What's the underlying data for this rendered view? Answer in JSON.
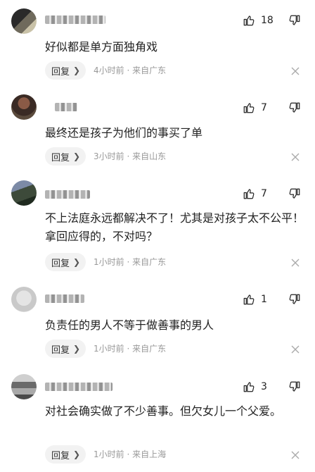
{
  "comments": [
    {
      "like_count": "18",
      "text": "好似都是单方面独角戏",
      "reply_label": "回复",
      "time": "4小时前",
      "location": "来自广东"
    },
    {
      "like_count": "7",
      "text": "最终还是孩子为他们的事买了单",
      "reply_label": "回复",
      "time": "3小时前",
      "location": "来自山东"
    },
    {
      "like_count": "7",
      "text": "不上法庭永远都解决不了！尤其是对孩子太不公平！拿回应得的，不对吗？",
      "reply_label": "回复",
      "time": "1小时前",
      "location": "来自广东"
    },
    {
      "like_count": "1",
      "text": "负责任的男人不等于做善事的男人",
      "reply_label": "回复",
      "time": "1小时前",
      "location": "来自广东"
    },
    {
      "like_count": "3",
      "text": "对社会确实做了不少善事。但欠女儿一个父爱。",
      "reply_label": "回复",
      "time": "1小时前",
      "location": "来自上海"
    }
  ],
  "meta_separator": "·",
  "icons": {
    "like": "thumbs-up-icon",
    "dislike": "thumbs-down-icon",
    "reply_chevron": "chevron-right-icon",
    "close": "close-icon"
  }
}
